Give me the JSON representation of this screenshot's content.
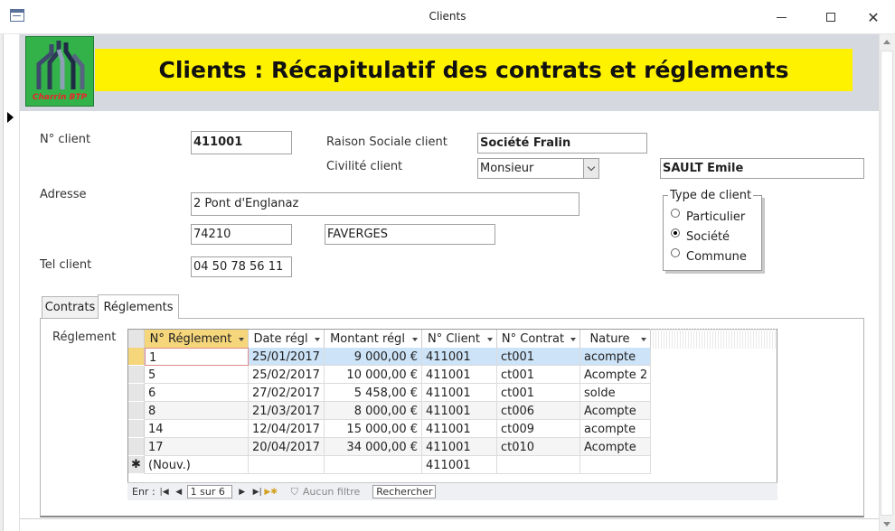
{
  "window": {
    "title": "Clients",
    "minimize_icon": "minimize-icon",
    "maximize_icon": "maximize-icon",
    "close_icon": "close-icon"
  },
  "header": {
    "logo_text": "Charrin BTP",
    "banner": "Clients : Récapitulatif des contrats et réglements",
    "banner_bg": "#fff200",
    "logo_bg": "#33b24a"
  },
  "form": {
    "client_no_label": "N° client",
    "client_no": "411001",
    "raison_label": "Raison Sociale  client",
    "raison": "Société Fralin",
    "civilite_label": "Civilité client",
    "civilite": "Monsieur",
    "contact": "SAULT Emile",
    "adresse_label": "Adresse",
    "adresse": "2 Pont d'Englanaz",
    "cp": "74210",
    "ville": "FAVERGES",
    "tel_label": "Tel client",
    "tel": "04 50 78 56 11",
    "type_label": "Type de client",
    "types": [
      "Particulier",
      "Société",
      "Commune"
    ],
    "type_selected": "Société"
  },
  "tabs": [
    {
      "label": "Contrats",
      "active": false
    },
    {
      "label": "Réglements",
      "active": true
    }
  ],
  "reglement": {
    "label": "Réglement",
    "columns": [
      "N° Réglement",
      "Date régl",
      "Montant régl",
      "N° Client",
      "N° Contrat",
      "Nature"
    ],
    "rows": [
      [
        "1",
        "25/01/2017",
        "9 000,00 €",
        "411001",
        "ct001",
        "acompte"
      ],
      [
        "5",
        "25/02/2017",
        "10 000,00 €",
        "411001",
        "ct001",
        "Acompte 2"
      ],
      [
        "6",
        "27/02/2017",
        "5 458,00 €",
        "411001",
        "ct001",
        "solde"
      ],
      [
        "8",
        "21/03/2017",
        "8 000,00 €",
        "411001",
        "ct006",
        "Acompte"
      ],
      [
        "14",
        "12/04/2017",
        "15 000,00 €",
        "411001",
        "ct009",
        "acompte"
      ],
      [
        "17",
        "20/04/2017",
        "34 000,00 €",
        "411001",
        "ct010",
        "Acompte"
      ]
    ],
    "new_row_label": "(Nouv.)",
    "new_row_client": "411001",
    "nav_label": "Enr :",
    "nav_record": "1 sur 6",
    "filter_label": "Aucun filtre",
    "search_label": "Rechercher"
  }
}
